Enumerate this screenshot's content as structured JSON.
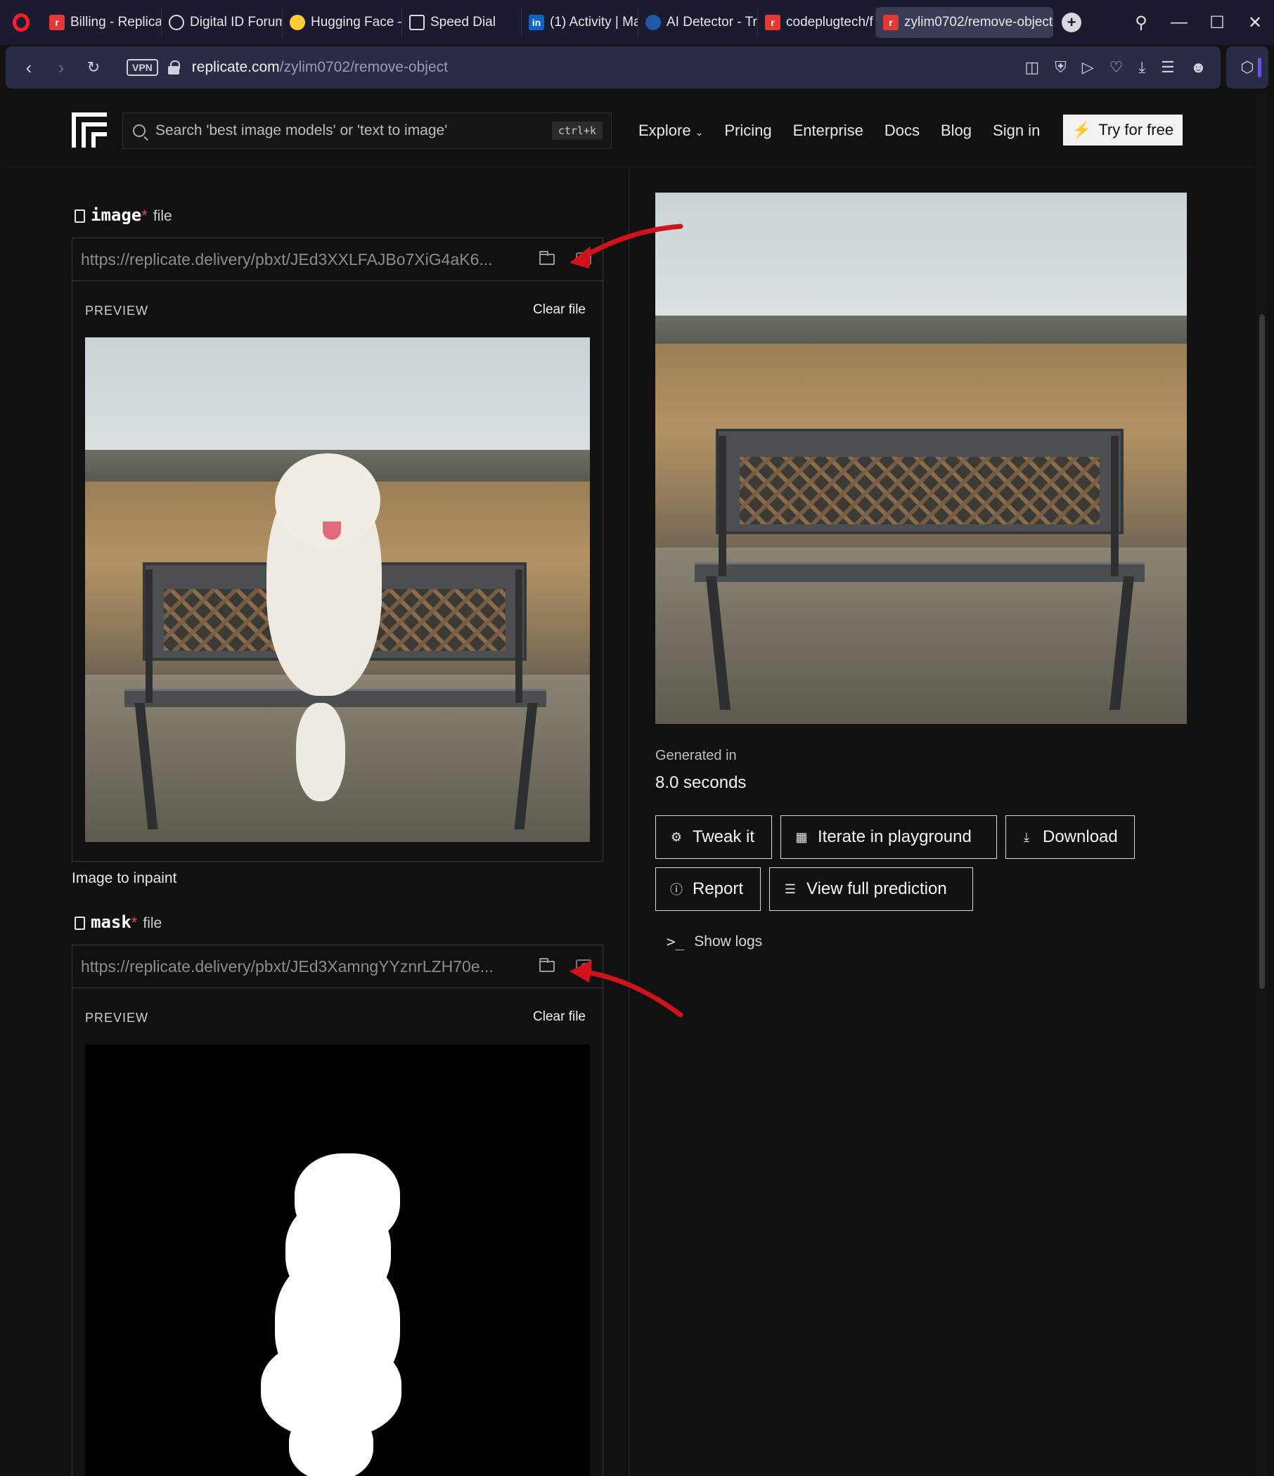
{
  "browser": {
    "tabs": [
      {
        "title": "Billing - Replicate",
        "icon": "replicate-icon"
      },
      {
        "title": "Digital ID Forum",
        "icon": "openai-icon"
      },
      {
        "title": "Hugging Face –",
        "icon": "hugging-face-icon"
      },
      {
        "title": "Speed Dial",
        "icon": "speed-dial-icon"
      },
      {
        "title": "(1) Activity | Ma",
        "icon": "linkedin-icon"
      },
      {
        "title": "AI Detector - Tr",
        "icon": "ai-detector-icon"
      },
      {
        "title": "codeplugtech/f",
        "icon": "replicate-icon"
      },
      {
        "title": "zylim0702/remove-object",
        "icon": "replicate-icon",
        "active": true
      }
    ],
    "vpn_label": "VPN",
    "url_host": "replicate.com",
    "url_path": "/zylim0702/remove-object"
  },
  "header": {
    "search_placeholder": "Search 'best image models' or 'text to image'",
    "search_shortcut": "ctrl+k",
    "nav": [
      "Explore",
      "Pricing",
      "Enterprise",
      "Docs",
      "Blog",
      "Sign in"
    ],
    "try_label": "Try for free"
  },
  "inputs": {
    "image": {
      "name": "image",
      "required_mark": "*",
      "type": "file",
      "url": "https://replicate.delivery/pbxt/JEd3XXLFAJBo7XiG4aK6...",
      "preview_label": "PREVIEW",
      "clear_label": "Clear file",
      "description": "Image to inpaint"
    },
    "mask": {
      "name": "mask",
      "required_mark": "*",
      "type": "file",
      "url": "https://replicate.delivery/pbxt/JEd3XamngYYznrLZH70e...",
      "preview_label": "PREVIEW",
      "clear_label": "Clear file"
    }
  },
  "output": {
    "generated_label": "Generated in",
    "generated_value": "8.0 seconds",
    "buttons": {
      "tweak": "Tweak it",
      "iterate": "Iterate in playground",
      "download": "Download",
      "report": "Report",
      "view_full": "View full prediction"
    },
    "show_logs": "Show logs"
  },
  "colors": {
    "background": "#111111",
    "required": "#e5484d",
    "annotation_arrow": "#d0121b",
    "browser_chrome": "#1a1b2e"
  }
}
